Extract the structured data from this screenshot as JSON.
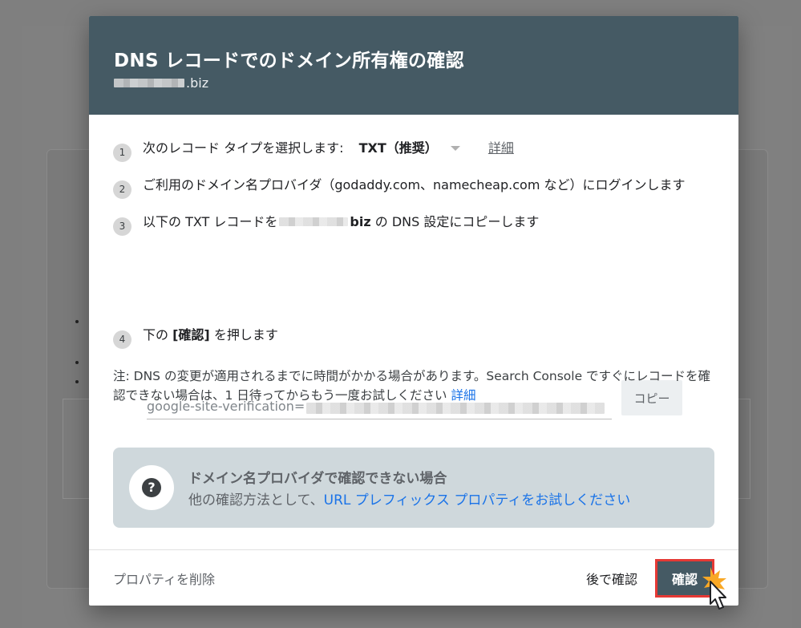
{
  "dialog": {
    "title": "DNS レコードでのドメイン所有権の確認",
    "subtitle_domain_suffix": ".biz",
    "steps": [
      {
        "num": "1",
        "text": "次のレコード タイプを選択します:",
        "record_type": "TXT（推奨）",
        "details_link": "詳細"
      },
      {
        "num": "2",
        "text": "ご利用のドメイン名プロバイダ（godaddy.com、namecheap.com など）にログインします"
      },
      {
        "num": "3",
        "text_before": "以下の TXT レコードを",
        "domain_suffix": "biz",
        "text_after": " の DNS 設定にコピーします"
      },
      {
        "num": "4",
        "text_before": "下の ",
        "bold": "[確認]",
        "text_after": " を押します"
      }
    ],
    "record_value_prefix": "google-site-verification=",
    "copy_label": "コピー",
    "note_text": "注: DNS の変更が適用されるまでに時間がかかる場合があります。Search Console ですぐにレコードを確認できない場合は、1 日待ってからもう一度お試しください ",
    "note_link": "詳細",
    "alt": {
      "title": "ドメイン名プロバイダで確認できない場合",
      "text_before": "他の確認方法として、",
      "link": "URL プレフィックス プロパティをお試しください"
    },
    "footer": {
      "delete_label": "プロパティを削除",
      "later_label": "後で確認",
      "confirm_label": "確認"
    }
  },
  "colors": {
    "header": "#455a64",
    "link": "#1a73e8",
    "highlight": "#e53935",
    "alt_box": "#cfd8dc"
  }
}
